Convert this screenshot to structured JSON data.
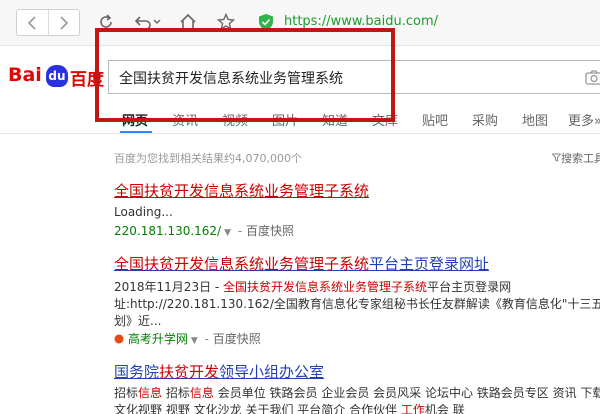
{
  "browser": {
    "back_icon": "chevron-left-icon",
    "forward_icon": "chevron-right-icon",
    "url": "https://www.baidu.com/"
  },
  "logo": {
    "bai": "Bai",
    "du": "du",
    "cn": "百度"
  },
  "search": {
    "query": "全国扶贫开发信息系统业务管理系统"
  },
  "tabs": [
    {
      "label": "网页",
      "active": true
    },
    {
      "label": "资讯"
    },
    {
      "label": "视频"
    },
    {
      "label": "图片"
    },
    {
      "label": "知道"
    },
    {
      "label": "文库"
    },
    {
      "label": "贴吧"
    },
    {
      "label": "采购"
    },
    {
      "label": "地图"
    },
    {
      "label": "更多»"
    }
  ],
  "results_meta": {
    "count_text": "百度为您找到相关结果约4,070,000个",
    "tools_label": "搜索工具"
  },
  "results": [
    {
      "title_red": "全国扶贫开发信息系统业务管理子系统",
      "line1": "Loading...",
      "url": "220.181.130.162/",
      "snapshot": "百度快照"
    },
    {
      "title_red": "全国扶贫开发信息系统业务管理子系统",
      "title_rest": "平台主页登录网址",
      "date_prefix": "2018年11月23日 - ",
      "date_red": "全国扶贫开发信息系统业务管理子系统",
      "date_rest": "平台主页登录网",
      "line2": "址:http://220.181.130.162/全国教育信息化专家组秘书长任友群解读《教育信息化\"十三五\"规",
      "line3": "划》近...",
      "url": "高考升学网",
      "snapshot": "百度快照"
    },
    {
      "title_prefix": "国务院",
      "title_red": "扶贫开发",
      "title_rest": "领导小组办公室",
      "line1_a": "招标",
      "line1_b": "信息",
      "line1_c": " 招标",
      "line1_d": "信息",
      "line1_e": " 会员单位 铁路会员 企业会员 会员风采 论坛中心 铁路会员专区 资讯 下载",
      "line2_a": "文化视野 视野 文化沙龙 关于我们 平台简介 合作伙伴 ",
      "line2_b": "工作",
      "line2_c": "机会 联"
    }
  ]
}
